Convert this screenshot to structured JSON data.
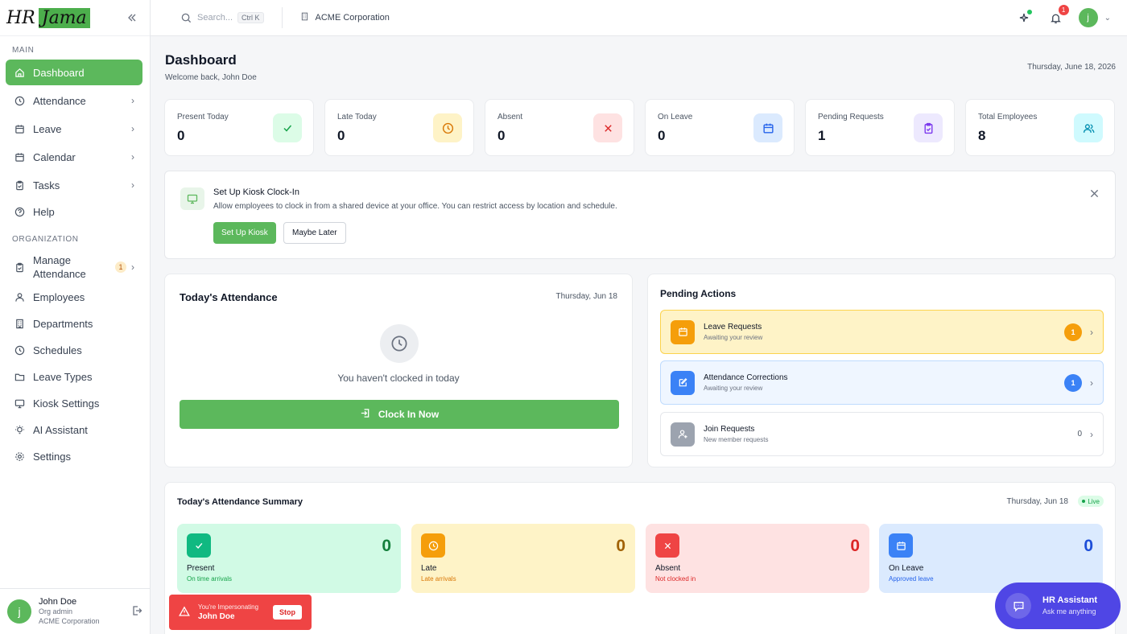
{
  "app": {
    "logo_left": "HR",
    "logo_right": "Jama"
  },
  "sidebar": {
    "section_main": "MAIN",
    "section_org": "ORGANIZATION",
    "main_items": [
      {
        "label": "Dashboard",
        "icon": "home-icon",
        "active": true
      },
      {
        "label": "Attendance",
        "icon": "clock-icon"
      },
      {
        "label": "Leave",
        "icon": "calendar-icon"
      },
      {
        "label": "Calendar",
        "icon": "calendar-icon"
      },
      {
        "label": "Tasks",
        "icon": "clipboard-icon"
      },
      {
        "label": "Help",
        "icon": "help-circle-icon"
      }
    ],
    "org_items": [
      {
        "label_line1": "Manage",
        "label_line2": "Attendance",
        "badge": "1",
        "icon": "clipboard-check-icon"
      },
      {
        "label": "Employees",
        "icon": "users-icon"
      },
      {
        "label": "Departments",
        "icon": "building-icon"
      },
      {
        "label": "Schedules",
        "icon": "clock-icon"
      },
      {
        "label": "Leave Types",
        "icon": "folder-icon"
      },
      {
        "label": "Kiosk Settings",
        "icon": "monitor-icon"
      },
      {
        "label": "AI Assistant",
        "icon": "lightbulb-icon"
      },
      {
        "label": "Settings",
        "icon": "gear-icon"
      }
    ],
    "user": {
      "initial": "j",
      "name": "John Doe",
      "role": "Org admin",
      "org": "ACME Corporation"
    }
  },
  "topbar": {
    "search_placeholder": "Search...",
    "search_shortcut": "Ctrl K",
    "org_name": "ACME Corporation",
    "notification_count": "1",
    "avatar_initial": "j"
  },
  "page": {
    "title": "Dashboard",
    "welcome": "Welcome back, John Doe",
    "date": "Thursday, June 18, 2026"
  },
  "stats": [
    {
      "label": "Present Today",
      "value": "0",
      "icon": "check-icon",
      "bg": "#dcfce7",
      "fg": "#16a34a"
    },
    {
      "label": "Late Today",
      "value": "0",
      "icon": "clock-icon",
      "bg": "#fef3c7",
      "fg": "#d97706"
    },
    {
      "label": "Absent",
      "value": "0",
      "icon": "x-icon",
      "bg": "#fee2e2",
      "fg": "#dc2626"
    },
    {
      "label": "On Leave",
      "value": "0",
      "icon": "calendar-icon",
      "bg": "#dbeafe",
      "fg": "#2563eb"
    },
    {
      "label": "Pending Requests",
      "value": "1",
      "icon": "clipboard-icon",
      "bg": "#ede9fe",
      "fg": "#7c3aed"
    },
    {
      "label": "Total Employees",
      "value": "8",
      "icon": "users-icon",
      "bg": "#cffafe",
      "fg": "#0891b2"
    }
  ],
  "kiosk": {
    "title": "Set Up Kiosk Clock-In",
    "description": "Allow employees to clock in from a shared device at your office. You can restrict access by location and schedule.",
    "primary_label": "Set Up Kiosk",
    "secondary_label": "Maybe Later"
  },
  "attendance": {
    "title": "Today's Attendance",
    "date": "Thursday, Jun 18",
    "message": "You haven't clocked in today",
    "button_label": "Clock In Now"
  },
  "pending": {
    "title": "Pending Actions",
    "rows": [
      {
        "title": "Leave Requests",
        "subtitle": "Awaiting your review",
        "count": "1",
        "icon": "calendar-icon",
        "bg": "#fef3c7",
        "border": "#fcd34d",
        "icon_bg": "#f59e0b",
        "badge_bg": "#f59e0b"
      },
      {
        "title": "Attendance Corrections",
        "subtitle": "Awaiting your review",
        "count": "1",
        "icon": "edit-icon",
        "bg": "#eff6ff",
        "border": "#bfdbfe",
        "icon_bg": "#3b82f6",
        "badge_bg": "#3b82f6"
      },
      {
        "title": "Join Requests",
        "subtitle": "New member requests",
        "count": "0",
        "icon": "user-plus-icon",
        "bg": "#ffffff",
        "border": "#e5e7eb",
        "icon_bg": "#9ca3af",
        "badge_bg": ""
      }
    ]
  },
  "summary": {
    "title": "Today's Attendance Summary",
    "date": "Thursday, Jun 18",
    "live_label": "Live",
    "tiles": [
      {
        "label": "Present",
        "sub": "On time arrivals",
        "value": "0",
        "icon": "check-icon",
        "bg": "#d1fae5",
        "icon_bg": "#10b981",
        "value_color": "#15803d",
        "sub_color": "#16a34a"
      },
      {
        "label": "Late",
        "sub": "Late arrivals",
        "value": "0",
        "icon": "clock-icon",
        "bg": "#fef3c7",
        "icon_bg": "#f59e0b",
        "value_color": "#a16207",
        "sub_color": "#d97706"
      },
      {
        "label": "Absent",
        "sub": "Not clocked in",
        "value": "0",
        "icon": "x-icon",
        "bg": "#fee2e2",
        "icon_bg": "#ef4444",
        "value_color": "#dc2626",
        "sub_color": "#dc2626"
      },
      {
        "label": "On Leave",
        "sub": "Approved leave",
        "value": "0",
        "icon": "calendar-icon",
        "bg": "#dbeafe",
        "icon_bg": "#3b82f6",
        "value_color": "#1d4ed8",
        "sub_color": "#2563eb"
      }
    ]
  },
  "impersonation": {
    "notice": "You're Impersonating",
    "name": "John Doe",
    "stop_label": "Stop"
  },
  "assistant": {
    "title": "HR Assistant",
    "subtitle": "Ask me anything"
  }
}
